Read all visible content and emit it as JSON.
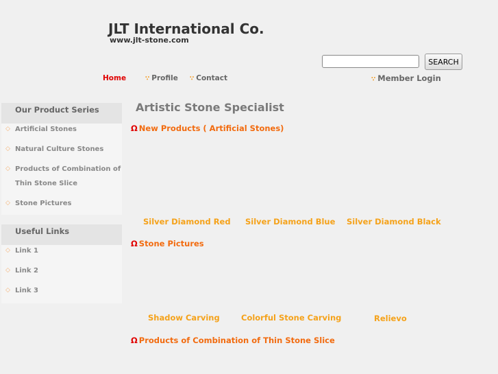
{
  "header": {
    "title": "JLT International Co.",
    "url": "www.jlt-stone.com"
  },
  "search": {
    "placeholder": "",
    "button_label": "SEARCH"
  },
  "nav": {
    "home": "Home",
    "profile": "Profile",
    "contact": "Contact",
    "member_login": "Member Login"
  },
  "sidebar": {
    "products": {
      "title": "Our Product Series",
      "items": [
        "Artificial Stones",
        "Natural Culture Stones",
        "Products of Combination of",
        "Thin Stone Slice",
        "Stone Pictures"
      ]
    },
    "links": {
      "title": "Useful Links",
      "items": [
        "Link 1",
        "Link 2",
        "Link 3"
      ]
    }
  },
  "main": {
    "title": "Artistic Stone Specialist",
    "sections": [
      {
        "marker": "Ω",
        "title": "New Products ( Artificial Stones)",
        "captions": [
          "Silver Diamond Red",
          "Silver Diamond Blue",
          "Silver Diamond Black"
        ]
      },
      {
        "marker": "Ω",
        "title": "Stone Pictures",
        "captions": [
          "Shadow Carving",
          "Colorful Stone Carving",
          "Relievo"
        ]
      },
      {
        "marker": "Ω",
        "title": "Products of Combination of Thin Stone Slice",
        "captions": []
      }
    ]
  },
  "icons": {
    "nav_bullet": "∵",
    "list_bullet": "◇"
  },
  "colors": {
    "accent_orange": "#f26b0f",
    "caption_orange": "#f5a21a",
    "active_red": "#e00000"
  }
}
